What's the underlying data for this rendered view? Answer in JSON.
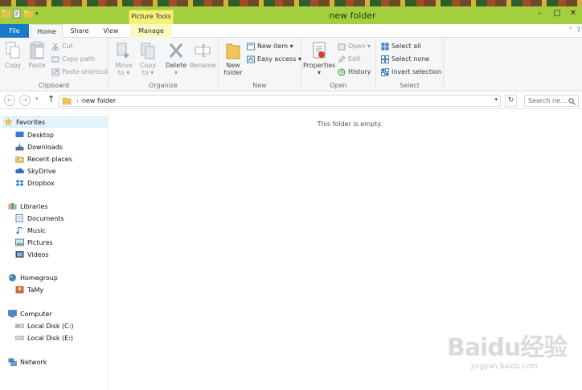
{
  "window": {
    "title": "new folder",
    "contextual_tab_group": "Picture Tools",
    "accent": "#a3cf3e",
    "controls": {
      "minimize": "–",
      "maximize": "▢",
      "close": "✕"
    }
  },
  "tabs": {
    "file": "File",
    "home": "Home",
    "share": "Share",
    "view": "View",
    "manage": "Manage"
  },
  "ribbon": {
    "clipboard": {
      "label": "Clipboard",
      "copy": "Copy",
      "paste": "Paste",
      "cut": "Cut",
      "copy_path": "Copy path",
      "paste_shortcut": "Paste shortcut"
    },
    "organize": {
      "label": "Organize",
      "move_to_1": "Move",
      "move_to_2": "to ▾",
      "copy_to_1": "Copy",
      "copy_to_2": "to ▾",
      "delete": "Delete",
      "delete_arrow": "▾",
      "rename": "Rename"
    },
    "new": {
      "label": "New",
      "new_folder_1": "New",
      "new_folder_2": "folder",
      "new_item": "New item ▾",
      "easy_access": "Easy access ▾"
    },
    "open": {
      "label": "Open",
      "properties": "Properties",
      "properties_arrow": "▾",
      "open": "Open ▾",
      "edit": "Edit",
      "history": "History"
    },
    "select": {
      "label": "Select",
      "select_all": "Select all",
      "select_none": "Select none",
      "invert_selection": "Invert selection"
    }
  },
  "address_bar": {
    "path": "new folder",
    "search_placeholder": "Search ne..."
  },
  "nav_pane": {
    "favorites": "Favorites",
    "desktop": "Desktop",
    "downloads": "Downloads",
    "recent_places": "Recent places",
    "skydrive": "SkyDrive",
    "dropbox": "Dropbox",
    "libraries": "Libraries",
    "documents": "Documents",
    "music": "Music",
    "pictures": "Pictures",
    "videos": "Videos",
    "homegroup": "Homegroup",
    "tamy": "TaMy",
    "computer": "Computer",
    "local_disk_c": "Local Disk (C:)",
    "local_disk_e": "Local Disk (E:)",
    "network": "Network"
  },
  "content": {
    "empty_message": "This folder is empty."
  },
  "watermark": {
    "logo": "Baidu经验",
    "url": "jingyan.baidu.com"
  }
}
